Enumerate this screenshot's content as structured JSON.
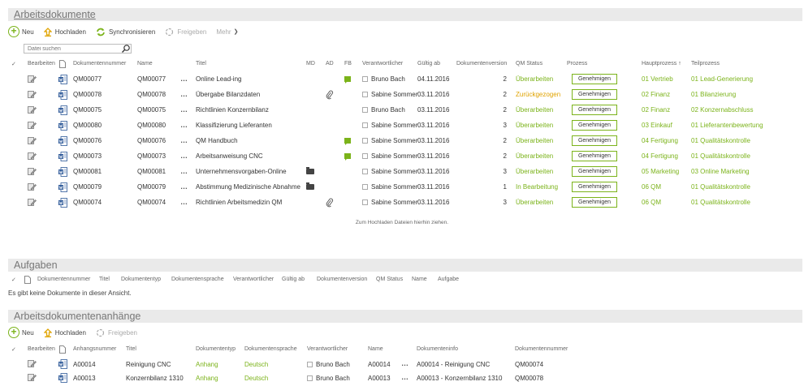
{
  "docs": {
    "title": "Arbeitsdokumente",
    "toolbar": {
      "new": "Neu",
      "upload": "Hochladen",
      "sync": "Synchronisieren",
      "release": "Freigeben",
      "more": "Mehr"
    },
    "search_placeholder": "Datei suchen",
    "headers": {
      "edit": "Bearbeiten",
      "docnum": "Dokumentennummer",
      "name": "Name",
      "title": "Titel",
      "md": "MD",
      "ad": "AD",
      "fb": "FB",
      "owner": "Verantwortlicher",
      "valid": "Gültig ab",
      "version": "Dokumentenversion",
      "qm": "QM Status",
      "process": "Prozess",
      "main_process": "Hauptprozess",
      "sub_process": "Teilprozess"
    },
    "rows": [
      {
        "docnum": "QM00077",
        "name": "QM00077",
        "title": "Online Lead-ing",
        "md": "",
        "ad": "",
        "fb": "comment",
        "owner": "Bruno Bach",
        "valid": "04.11.2016",
        "version": "2",
        "qm": "Überarbeiten",
        "qm_color": "green",
        "process": "Genehmigen",
        "main": "01 Vertrieb",
        "sub": "01 Lead-Generierung"
      },
      {
        "docnum": "QM00078",
        "name": "QM00078",
        "title": "Übergabe Bilanzdaten",
        "md": "",
        "ad": "clip",
        "fb": "",
        "owner": "Sabine Sommer",
        "valid": "03.11.2016",
        "version": "2",
        "qm": "Zurückgezogen",
        "qm_color": "orange",
        "process": "Genehmigen",
        "main": "02 Finanz",
        "sub": "01 Bilanzierung"
      },
      {
        "docnum": "QM00075",
        "name": "QM00075",
        "title": "Richtlinien Konzernbilanz",
        "md": "",
        "ad": "",
        "fb": "",
        "owner": "Bruno Bach",
        "valid": "03.11.2016",
        "version": "2",
        "qm": "Überarbeiten",
        "qm_color": "green",
        "process": "Genehmigen",
        "main": "02 Finanz",
        "sub": "02 Konzernabschluss"
      },
      {
        "docnum": "QM00080",
        "name": "QM00080",
        "title": "Klassifizierung Lieferanten",
        "md": "",
        "ad": "",
        "fb": "",
        "owner": "Sabine Sommer",
        "valid": "03.11.2016",
        "version": "3",
        "qm": "Überarbeiten",
        "qm_color": "green",
        "process": "Genehmigen",
        "main": "03 Einkauf",
        "sub": "01 Lieferantenbewertung"
      },
      {
        "docnum": "QM00076",
        "name": "QM00076",
        "title": "QM Handbuch",
        "md": "",
        "ad": "",
        "fb": "comment",
        "owner": "Sabine Sommer",
        "valid": "03.11.2016",
        "version": "2",
        "qm": "Überarbeiten",
        "qm_color": "green",
        "process": "Genehmigen",
        "main": "04 Fertigung",
        "sub": "01 Qualitätskontrolle"
      },
      {
        "docnum": "QM00073",
        "name": "QM00073",
        "title": "Arbeitsanweisung CNC",
        "md": "",
        "ad": "",
        "fb": "comment",
        "owner": "Sabine Sommer",
        "valid": "03.11.2016",
        "version": "2",
        "qm": "Überarbeiten",
        "qm_color": "green",
        "process": "Genehmigen",
        "main": "04 Fertigung",
        "sub": "01 Qualitätskontrolle"
      },
      {
        "docnum": "QM00081",
        "name": "QM00081",
        "title": "Unternehmensvorgaben-Online",
        "md": "folder",
        "ad": "",
        "fb": "",
        "owner": "Sabine Sommer",
        "valid": "03.11.2016",
        "version": "3",
        "qm": "Überarbeiten",
        "qm_color": "green",
        "process": "Genehmigen",
        "main": "05 Marketing",
        "sub": "03 Online Marketing"
      },
      {
        "docnum": "QM00079",
        "name": "QM00079",
        "title": "Abstimmung Medizinische Abnahme",
        "md": "folder",
        "ad": "",
        "fb": "",
        "owner": "Sabine Sommer",
        "valid": "03.11.2016",
        "version": "1",
        "qm": "In Bearbeitung",
        "qm_color": "green",
        "process": "Genehmigen",
        "main": "06 QM",
        "sub": "01 Qualitätskontrolle"
      },
      {
        "docnum": "QM00074",
        "name": "QM00074",
        "title": "Richtlinien Arbeitsmedizin QM",
        "md": "",
        "ad": "clip",
        "fb": "",
        "owner": "Sabine Sommer",
        "valid": "03.11.2016",
        "version": "3",
        "qm": "Überarbeiten",
        "qm_color": "green",
        "process": "Genehmigen",
        "main": "06 QM",
        "sub": "01 Qualitätskontrolle"
      }
    ],
    "drop_hint": "Zum Hochladen Dateien hierhin ziehen."
  },
  "tasks": {
    "title": "Aufgaben",
    "headers": [
      "Dokumentennummer",
      "Titel",
      "Dokumententyp",
      "Dokumentensprache",
      "Verantwortlicher",
      "Gültig ab",
      "Dokumentenversion",
      "QM Status",
      "Name",
      "Aufgabe"
    ],
    "empty": "Es gibt keine Dokumente in dieser Ansicht."
  },
  "attachments": {
    "title": "Arbeitsdokumentenanhänge",
    "toolbar": {
      "new": "Neu",
      "upload": "Hochladen",
      "release": "Freigeben"
    },
    "headers": {
      "edit": "Bearbeiten",
      "num": "Anhangsnummer",
      "title": "Titel",
      "type": "Dokumententyp",
      "lang": "Dokumentensprache",
      "owner": "Verantwortlicher",
      "name": "Name",
      "info": "Dokumenteninfo",
      "docnum": "Dokumentennummer"
    },
    "rows": [
      {
        "num": "A00014",
        "title": "Reinigung CNC",
        "type": "Anhang",
        "lang": "Deutsch",
        "owner": "Bruno Bach",
        "name": "A00014",
        "info": "A00014 - Reinigung CNC",
        "docnum": "QM00074"
      },
      {
        "num": "A00013",
        "title": "Konzernbilanz 1310",
        "type": "Anhang",
        "lang": "Deutsch",
        "owner": "Bruno Bach",
        "name": "A00013",
        "info": "A00013 - Konzernbilanz 1310",
        "docnum": "QM00078"
      }
    ]
  },
  "colors": {
    "accent": "#7bb31a",
    "warning": "#e0a300"
  }
}
